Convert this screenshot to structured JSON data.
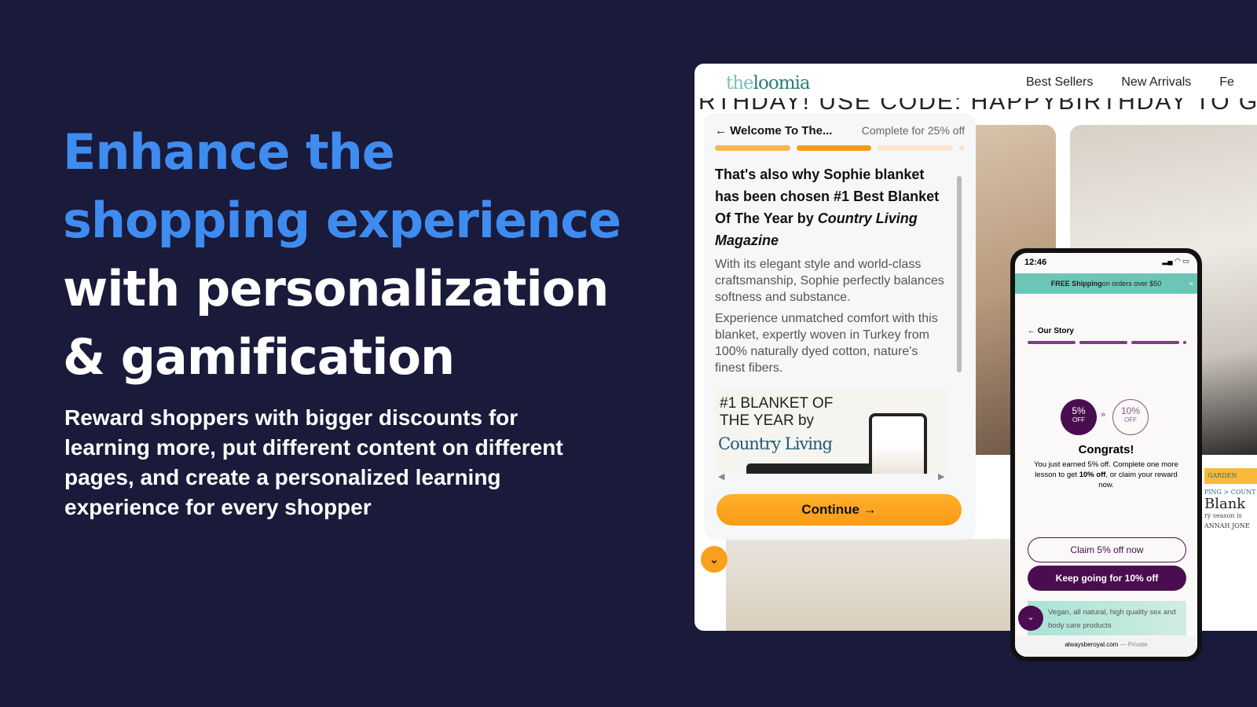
{
  "hero": {
    "line1": "Enhance the",
    "line2": "shopping experience",
    "line3": "with personalization",
    "line4": "& gamification",
    "subtitle": "Reward shoppers with bigger discounts for learning more, put different content on different pages, and create a personalized learning experience for every shopper"
  },
  "colors": {
    "background": "#1a1a3b",
    "accent_blue": "#3f8cf0",
    "orange": "#fa9a14",
    "purple": "#4a0d4f",
    "teal": "#6cc6b8"
  },
  "browser": {
    "logo_a": "the",
    "logo_b": "loomia",
    "nav": [
      "Best Sellers",
      "New Arrivals",
      "Fe"
    ],
    "banner": "RTHDAY! USE CODE: HAPPYBIRTHDAY TO GET"
  },
  "quiz": {
    "back_icon": "arrow-left-icon",
    "title": "Welcome To The...",
    "reward": "Complete for 25% off",
    "progress": [
      1,
      1,
      0,
      0
    ],
    "heading": "That's also why Sophie blanket has been chosen #1 Best Blanket Of The Year by ",
    "heading_em": "Country Living Magazine",
    "p1": "With its elegant style and world-class craftsmanship, Sophie perfectly balances softness and substance.",
    "p2": "Experience unmatched comfort with this blanket, expertly woven in Turkey from 100% naturally dyed cotton, nature's finest fibers.",
    "mag_line1": "#1 BLANKET OF",
    "mag_line2": "THE YEAR by",
    "mag_brand": "Country Living",
    "continue": "Continue →"
  },
  "phone": {
    "time": "12:46",
    "shipping_a": "FREE Shipping",
    "shipping_b": " on orders over $50",
    "story": "← Our Story",
    "progress": [
      1,
      1,
      1,
      0
    ],
    "badge1_pct": "5%",
    "badge1_off": "OFF",
    "badge2_pct": "10%",
    "badge2_off": "OFF",
    "arrows": "»",
    "congrats": "Congrats!",
    "msg_a": "You just earned 5% off. Complete one more lesson to get ",
    "msg_b": "10% off",
    "msg_c": ", or claim your reward now.",
    "claim": "Claim 5% off now",
    "keep": "Keep going for 10% off",
    "promo": "Vegan, all natural, high quality sex and body care products",
    "url": "alwaysberoyal.com",
    "private": " — Private"
  },
  "side_article": {
    "crumb": "GARDEN",
    "crumb2": "PING > COUNT",
    "title": "Blank",
    "line": "ry season is",
    "author": "ANNAH JONE"
  }
}
